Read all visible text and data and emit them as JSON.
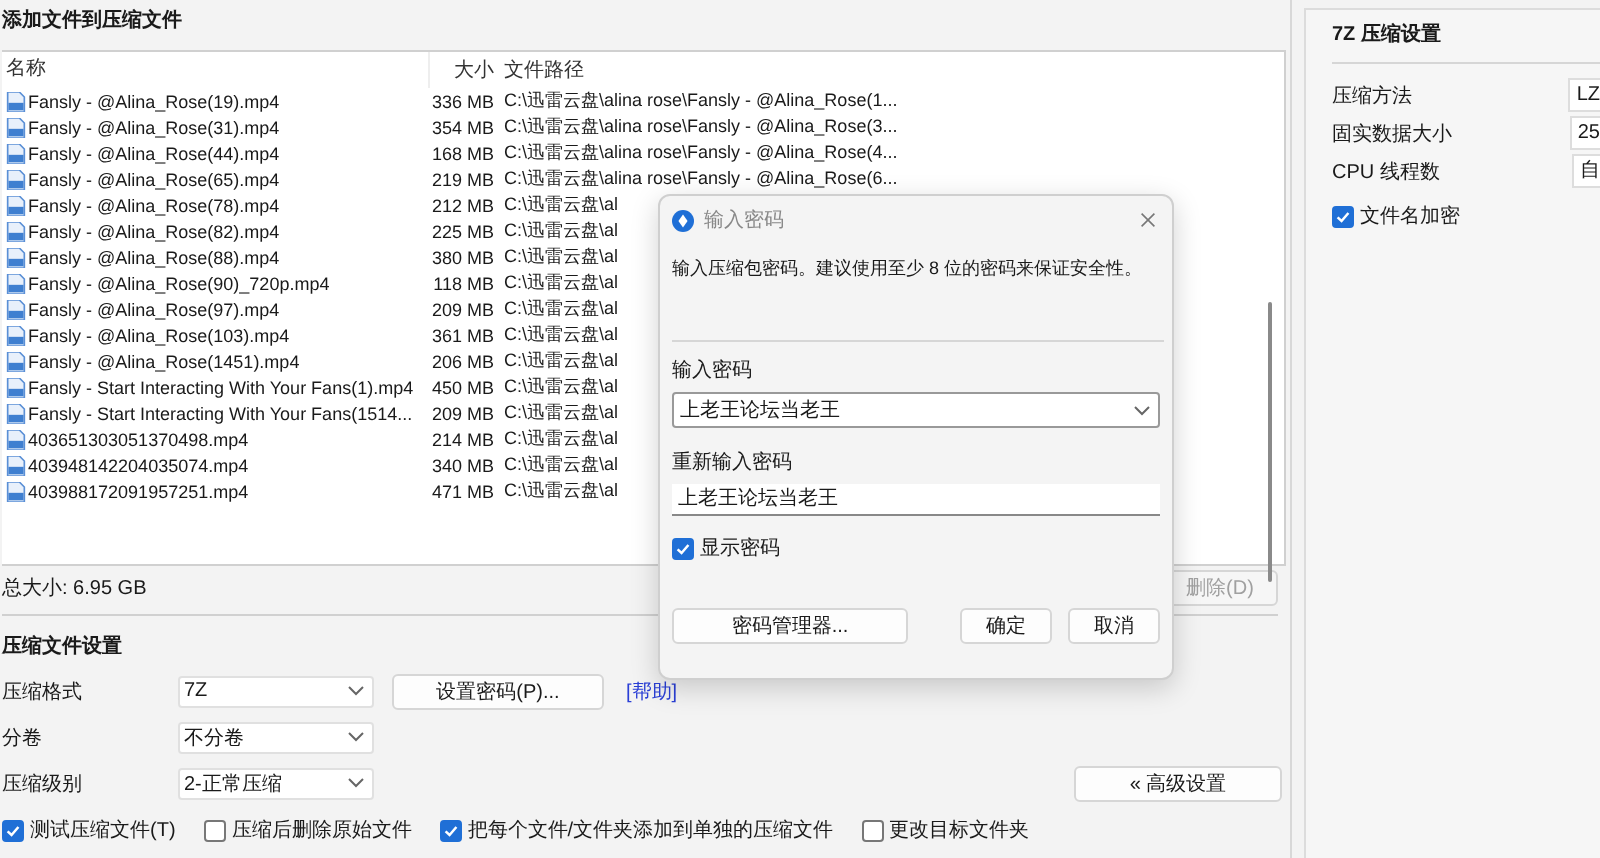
{
  "main": {
    "title": "添加文件到压缩文件",
    "file_list": {
      "columns": [
        "名称",
        "大小",
        "文件路径"
      ],
      "rows": [
        {
          "name": "Fansly - @Alina_Rose(19).mp4",
          "size": "336 MB",
          "path": "C:\\迅雷云盘\\alina rose\\Fansly - @Alina_Rose(1..."
        },
        {
          "name": "Fansly - @Alina_Rose(31).mp4",
          "size": "354 MB",
          "path": "C:\\迅雷云盘\\alina rose\\Fansly - @Alina_Rose(3..."
        },
        {
          "name": "Fansly - @Alina_Rose(44).mp4",
          "size": "168 MB",
          "path": "C:\\迅雷云盘\\alina rose\\Fansly - @Alina_Rose(4..."
        },
        {
          "name": "Fansly - @Alina_Rose(65).mp4",
          "size": "219 MB",
          "path": "C:\\迅雷云盘\\alina rose\\Fansly - @Alina_Rose(6..."
        },
        {
          "name": "Fansly - @Alina_Rose(78).mp4",
          "size": "212 MB",
          "path": "C:\\迅雷云盘\\al"
        },
        {
          "name": "Fansly - @Alina_Rose(82).mp4",
          "size": "225 MB",
          "path": "C:\\迅雷云盘\\al"
        },
        {
          "name": "Fansly - @Alina_Rose(88).mp4",
          "size": "380 MB",
          "path": "C:\\迅雷云盘\\al"
        },
        {
          "name": "Fansly - @Alina_Rose(90)_720p.mp4",
          "size": "118 MB",
          "path": "C:\\迅雷云盘\\al"
        },
        {
          "name": "Fansly - @Alina_Rose(97).mp4",
          "size": "209 MB",
          "path": "C:\\迅雷云盘\\al"
        },
        {
          "name": "Fansly - @Alina_Rose(103).mp4",
          "size": "361 MB",
          "path": "C:\\迅雷云盘\\al"
        },
        {
          "name": "Fansly - @Alina_Rose(1451).mp4",
          "size": "206 MB",
          "path": "C:\\迅雷云盘\\al"
        },
        {
          "name": "Fansly - Start Interacting With Your Fans(1).mp4",
          "size": "450 MB",
          "path": "C:\\迅雷云盘\\al"
        },
        {
          "name": "Fansly - Start Interacting With Your Fans(1514...",
          "size": "209 MB",
          "path": "C:\\迅雷云盘\\al"
        },
        {
          "name": "403651303051370498.mp4",
          "size": "214 MB",
          "path": "C:\\迅雷云盘\\al"
        },
        {
          "name": "403948142204035074.mp4",
          "size": "340 MB",
          "path": "C:\\迅雷云盘\\al"
        },
        {
          "name": "403988172091957251.mp4",
          "size": "471 MB",
          "path": "C:\\迅雷云盘\\al"
        }
      ]
    },
    "total_size": "总大小: 6.95 GB",
    "delete_button": {
      "label": "删除(D)",
      "disabled": true
    },
    "settings": {
      "title": "压缩文件设置",
      "rows": [
        {
          "label": "压缩格式",
          "value": "7Z"
        },
        {
          "label": "分卷",
          "value": "不分卷"
        },
        {
          "label": "压缩级别",
          "value": "2-正常压缩"
        }
      ],
      "set_password_button": "设置密码(P)...",
      "help_link": "[帮助]",
      "advanced_button": "« 高级设置"
    },
    "options": [
      {
        "label": "测试压缩文件(T)",
        "checked": true
      },
      {
        "label": "压缩后删除原始文件",
        "checked": false
      },
      {
        "label": "把每个文件/文件夹添加到单独的压缩文件",
        "checked": true
      },
      {
        "label": "更改目标文件夹",
        "checked": false
      }
    ]
  },
  "side_panel": {
    "title": "7Z 压缩设置",
    "rows": [
      {
        "label": "压缩方法",
        "value": "LZ"
      },
      {
        "label": "固实数据大小",
        "value": "25"
      },
      {
        "label": "CPU 线程数",
        "value": "自"
      }
    ],
    "filename_encrypt": {
      "label": "文件名加密",
      "checked": true
    }
  },
  "dialog": {
    "title": "输入密码",
    "message": "输入压缩包密码。建议使用至少 8 位的密码来保证安全性。",
    "password_label": "输入密码",
    "password_value": "上老王论坛当老王",
    "confirm_label": "重新输入密码",
    "confirm_value": "上老王论坛当老王",
    "show_password": {
      "label": "显示密码",
      "checked": true
    },
    "buttons": [
      "密码管理器...",
      "确定",
      "取消"
    ]
  }
}
